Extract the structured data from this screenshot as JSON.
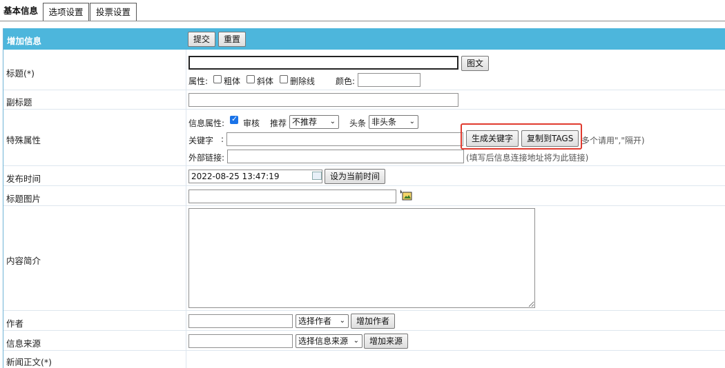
{
  "tabs": [
    "基本信息",
    "选项设置",
    "投票设置"
  ],
  "header": {
    "title": "增加信息",
    "submit": "提交",
    "reset": "重置"
  },
  "title_row": {
    "label": "标题(*)",
    "value": "",
    "tuwen": "图文",
    "attr_label": "属性:",
    "bold": "粗体",
    "italic": "斜体",
    "strike": "删除线",
    "color_label": "颜色:",
    "color_value": ""
  },
  "subtitle_row": {
    "label": "副标题",
    "value": ""
  },
  "special_row": {
    "label": "特殊属性",
    "info_attr_label": "信息属性:",
    "review": "审核",
    "review_checked": true,
    "recommend_label": "推荐",
    "recommend_value": "不推荐",
    "headline_label": "头条",
    "headline_value": "非头条",
    "keyword_label": "关键字",
    "keyword_colon": ":",
    "keyword_value": "",
    "gen_keyword": "生成关键字",
    "copy_tags": "复制到TAGS",
    "keyword_hint": "多个请用\",\"隔开)",
    "external_label": "外部链接:",
    "external_value": "",
    "external_hint": "(填写后信息连接地址将为此链接)"
  },
  "publish_row": {
    "label": "发布时间",
    "value": "2022-08-25 13:47:19",
    "set_now": "设为当前时间"
  },
  "titlepic_row": {
    "label": "标题图片",
    "value": ""
  },
  "summary_row": {
    "label": "内容简介",
    "value": ""
  },
  "author_row": {
    "label": "作者",
    "value": "",
    "select": "选择作者",
    "add": "增加作者"
  },
  "source_row": {
    "label": "信息来源",
    "value": "",
    "select": "选择信息来源",
    "add": "增加来源"
  },
  "content_row": {
    "label": "新闻正文(*)"
  },
  "colors": {
    "header_bg": "#4db6dc",
    "highlight": "#e03a2e",
    "checkbox": "#1a73e8"
  }
}
